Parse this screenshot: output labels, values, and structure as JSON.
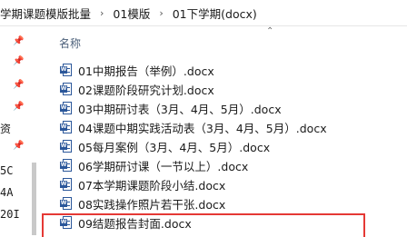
{
  "breadcrumb": {
    "items": [
      "学期课题模版批量",
      "01模版",
      "01下学期(docx)"
    ],
    "separator": "›"
  },
  "nav": {
    "labels": [
      "资",
      "5C",
      "4A",
      "20I"
    ]
  },
  "list": {
    "column_header": "名称",
    "files": [
      "01中期报告（举例）.docx",
      "02课题阶段研究计划.docx",
      "03中期研讨表（3月、4月、5月）.docx",
      "04课题中期实践活动表（3月、4月、5月）.docx",
      "05每月案例（3月、4月、5月）.docx",
      "06学期研讨课（一节以上）.docx",
      "07本学期课题阶段小结.docx",
      "08实践操作照片若干张.docx",
      "09结题报告封面.docx"
    ]
  },
  "colors": {
    "highlight": "#e53935",
    "word_blue": "#2b579a"
  }
}
